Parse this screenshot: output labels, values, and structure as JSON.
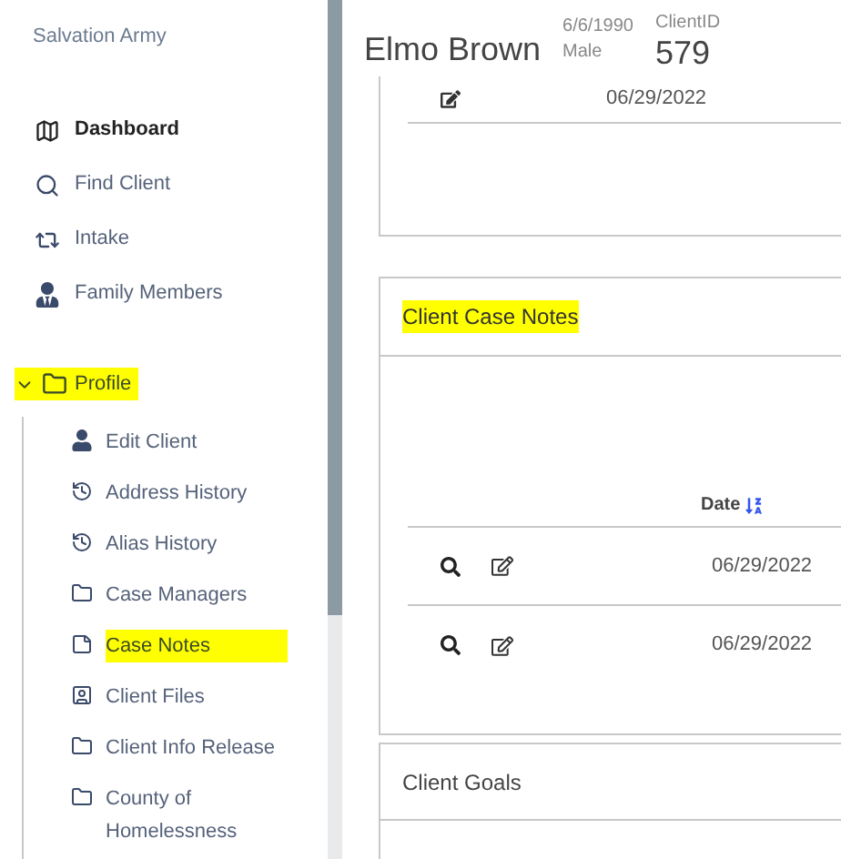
{
  "sidebar": {
    "org": "Salvation Army",
    "nav": [
      {
        "label": "Dashboard",
        "selected": true
      },
      {
        "label": "Find Client",
        "selected": false
      },
      {
        "label": "Intake",
        "selected": false
      },
      {
        "label": "Family Members",
        "selected": false
      }
    ],
    "profile": {
      "label": "Profile",
      "expanded": true,
      "highlighted": true,
      "children": [
        {
          "label": "Edit Client",
          "highlighted": false
        },
        {
          "label": "Address History",
          "highlighted": false
        },
        {
          "label": "Alias History",
          "highlighted": false
        },
        {
          "label": "Case Managers",
          "highlighted": false
        },
        {
          "label": "Case Notes",
          "highlighted": true
        },
        {
          "label": "Client Files",
          "highlighted": false
        },
        {
          "label": "Client Info Release",
          "highlighted": false
        },
        {
          "label": "County of Homelessness",
          "highlighted": false
        }
      ]
    }
  },
  "header": {
    "name": "Elmo Brown",
    "dob": "6/6/1990",
    "sex": "Male",
    "id_label": "ClientID",
    "id": "579"
  },
  "top_card": {
    "rows": [
      {
        "date": "06/29/2022"
      }
    ]
  },
  "case_notes": {
    "title": "Client Case Notes",
    "title_highlighted": true,
    "columns": [
      "Date"
    ],
    "rows": [
      {
        "date": "06/29/2022"
      },
      {
        "date": "06/29/2022"
      }
    ]
  },
  "goals": {
    "title": "Client Goals"
  }
}
